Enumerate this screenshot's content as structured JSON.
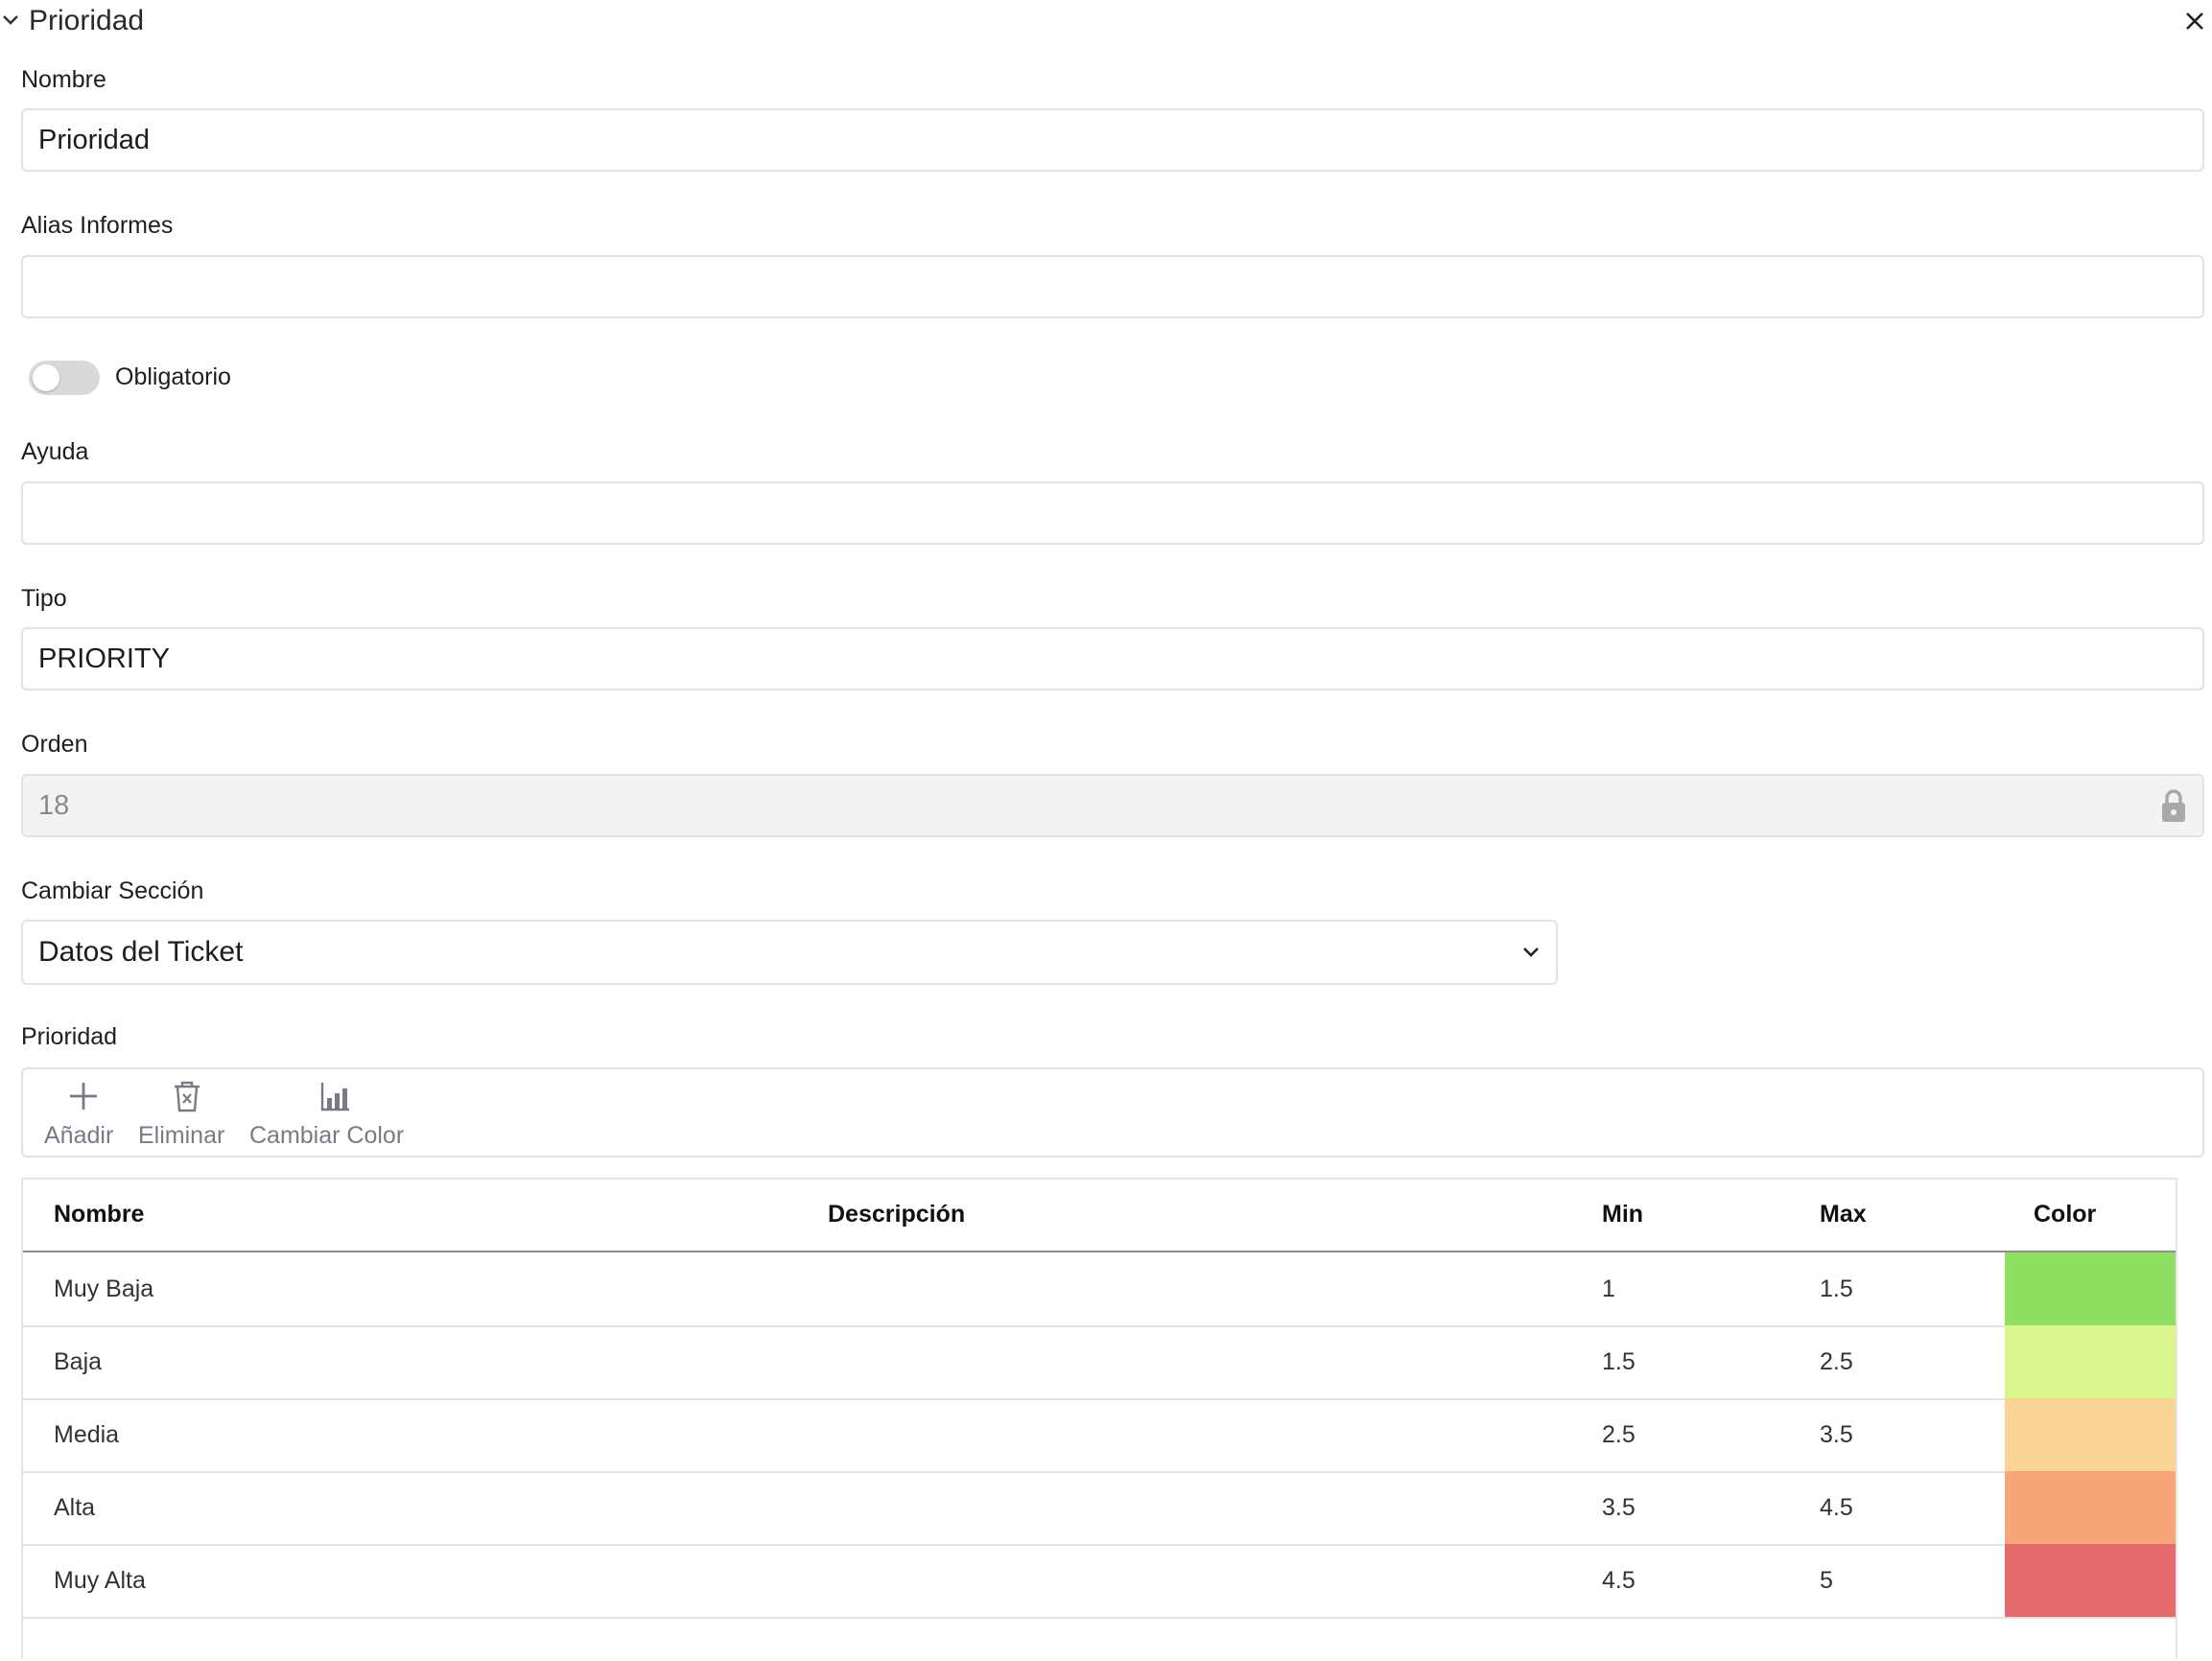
{
  "header": {
    "title": "Prioridad",
    "collapse_icon": "chevron-down-icon",
    "close_icon": "close-icon"
  },
  "form": {
    "nombre": {
      "label": "Nombre",
      "value": "Prioridad"
    },
    "alias": {
      "label": "Alias Informes",
      "value": ""
    },
    "obligatorio": {
      "label": "Obligatorio",
      "checked": false
    },
    "ayuda": {
      "label": "Ayuda",
      "value": ""
    },
    "tipo": {
      "label": "Tipo",
      "value": "PRIORITY"
    },
    "orden": {
      "label": "Orden",
      "value": "18",
      "locked": true
    },
    "seccion": {
      "label": "Cambiar Sección",
      "value": "Datos del Ticket"
    }
  },
  "priority": {
    "label": "Prioridad",
    "toolbar": {
      "add": "Añadir",
      "delete": "Eliminar",
      "change_color": "Cambiar Color"
    },
    "columns": [
      "Nombre",
      "Descripción",
      "Min",
      "Max",
      "Color"
    ],
    "rows": [
      {
        "nombre": "Muy Baja",
        "descripcion": "",
        "min": "1",
        "max": "1.5",
        "color": "#8fe062"
      },
      {
        "nombre": "Baja",
        "descripcion": "",
        "min": "1.5",
        "max": "2.5",
        "color": "#dbf58d"
      },
      {
        "nombre": "Media",
        "descripcion": "",
        "min": "2.5",
        "max": "3.5",
        "color": "#f8d595"
      },
      {
        "nombre": "Alta",
        "descripcion": "",
        "min": "3.5",
        "max": "4.5",
        "color": "#f7a679"
      },
      {
        "nombre": "Muy Alta",
        "descripcion": "",
        "min": "4.5",
        "max": "5",
        "color": "#e56a6e"
      }
    ]
  }
}
